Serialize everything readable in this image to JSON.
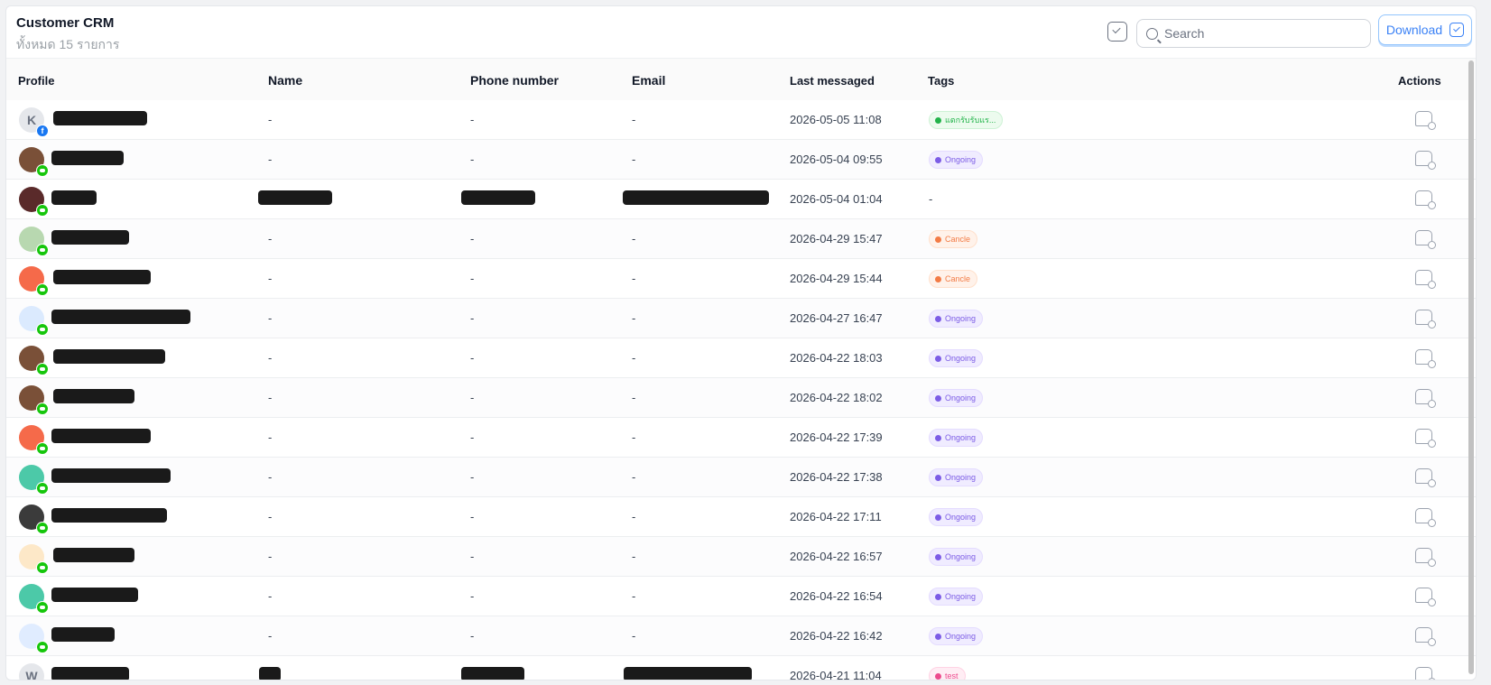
{
  "header": {
    "title": "Customer CRM",
    "subtitle": "ทั้งหมด 15 รายการ",
    "search_placeholder": "Search",
    "download_label": "Download"
  },
  "columns": {
    "profile": "Profile",
    "name": "Name",
    "phone": "Phone number",
    "email": "Email",
    "last_messaged": "Last messaged",
    "tags": "Tags",
    "actions": "Actions"
  },
  "rows": [
    {
      "avatar": "K",
      "avatar_color": "#e5e7eb",
      "channel": "facebook",
      "name": "-",
      "phone": "-",
      "email": "-",
      "last_messaged": "2026-05-05 11:08",
      "tag": "แตกรับรับแร...",
      "tag_style": "green"
    },
    {
      "avatar": "",
      "avatar_color": "#7a5038",
      "channel": "line",
      "name": "-",
      "phone": "-",
      "email": "-",
      "last_messaged": "2026-05-04 09:55",
      "tag": "Ongoing",
      "tag_style": "ongoing"
    },
    {
      "avatar": "",
      "avatar_color": "#5a2a2a",
      "channel": "line",
      "name": "",
      "phone": "",
      "email": "",
      "last_messaged": "2026-05-04 01:04",
      "tag": "-",
      "tag_style": "none"
    },
    {
      "avatar": "",
      "avatar_color": "#b8d8b0",
      "channel": "line",
      "name": "-",
      "phone": "-",
      "email": "-",
      "last_messaged": "2026-04-29 15:47",
      "tag": "Cancle",
      "tag_style": "cancle"
    },
    {
      "avatar": "",
      "avatar_color": "#f56a4a",
      "channel": "line",
      "name": "-",
      "phone": "-",
      "email": "-",
      "last_messaged": "2026-04-29 15:44",
      "tag": "Cancle",
      "tag_style": "cancle"
    },
    {
      "avatar": "",
      "avatar_color": "#dbeafe",
      "channel": "line",
      "name": "-",
      "phone": "-",
      "email": "-",
      "last_messaged": "2026-04-27 16:47",
      "tag": "Ongoing",
      "tag_style": "ongoing"
    },
    {
      "avatar": "",
      "avatar_color": "#7a5038",
      "channel": "line",
      "name": "-",
      "phone": "-",
      "email": "-",
      "last_messaged": "2026-04-22 18:03",
      "tag": "Ongoing",
      "tag_style": "ongoing"
    },
    {
      "avatar": "",
      "avatar_color": "#7a5038",
      "channel": "line",
      "name": "-",
      "phone": "-",
      "email": "-",
      "last_messaged": "2026-04-22 18:02",
      "tag": "Ongoing",
      "tag_style": "ongoing"
    },
    {
      "avatar": "",
      "avatar_color": "#f56a4a",
      "channel": "line",
      "name": "-",
      "phone": "-",
      "email": "-",
      "last_messaged": "2026-04-22 17:39",
      "tag": "Ongoing",
      "tag_style": "ongoing"
    },
    {
      "avatar": "",
      "avatar_color": "#4cc9a8",
      "channel": "line",
      "name": "-",
      "phone": "-",
      "email": "-",
      "last_messaged": "2026-04-22 17:38",
      "tag": "Ongoing",
      "tag_style": "ongoing"
    },
    {
      "avatar": "",
      "avatar_color": "#3b3b3b",
      "channel": "line",
      "name": "-",
      "phone": "-",
      "email": "-",
      "last_messaged": "2026-04-22 17:11",
      "tag": "Ongoing",
      "tag_style": "ongoing"
    },
    {
      "avatar": "",
      "avatar_color": "#fde8c8",
      "channel": "line",
      "name": "-",
      "phone": "-",
      "email": "-",
      "last_messaged": "2026-04-22 16:57",
      "tag": "Ongoing",
      "tag_style": "ongoing"
    },
    {
      "avatar": "",
      "avatar_color": "#4cc9a8",
      "channel": "line",
      "name": "-",
      "phone": "-",
      "email": "-",
      "last_messaged": "2026-04-22 16:54",
      "tag": "Ongoing",
      "tag_style": "ongoing"
    },
    {
      "avatar": "",
      "avatar_color": "#e0ecff",
      "channel": "line",
      "name": "-",
      "phone": "-",
      "email": "-",
      "last_messaged": "2026-04-22 16:42",
      "tag": "Ongoing",
      "tag_style": "ongoing"
    },
    {
      "avatar": "W",
      "avatar_color": "#e5e7eb",
      "channel": "line",
      "name": "",
      "phone": "",
      "email": "",
      "last_messaged": "2026-04-21 11:04",
      "tag": "test",
      "tag_style": "pink"
    }
  ],
  "colors": {
    "accent": "#3b82f6",
    "line_green": "#16c60c",
    "facebook_blue": "#1877f2",
    "ongoing_purple": "#7c5ce6",
    "cancle_orange": "#f37b45"
  }
}
